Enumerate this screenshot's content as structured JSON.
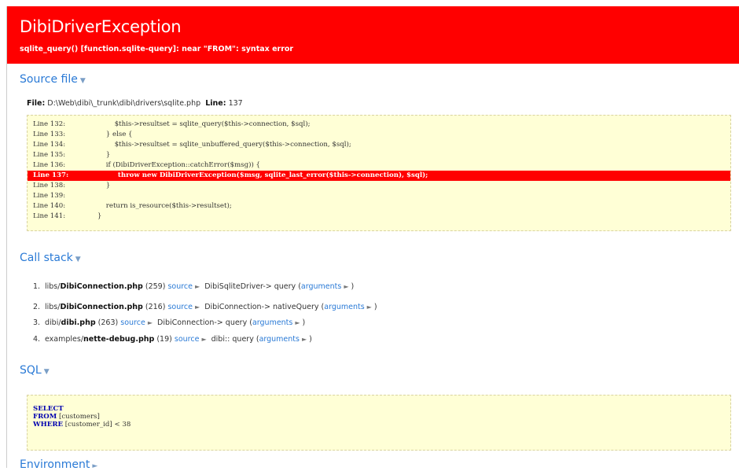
{
  "header": {
    "title": "DibiDriverException",
    "message": "sqlite_query() [function.sqlite-query]: near \"FROM\": syntax error"
  },
  "source_file": {
    "heading": "Source file",
    "toggle": "▼",
    "file_label": "File:",
    "file_path": "D:\\Web\\dibi\\_trunk\\dibi\\drivers\\sqlite.php",
    "line_label": "Line:",
    "line_number": "137",
    "lines": [
      {
        "ln": "Line 132:",
        "code": "                $this->resultset = sqlite_query($this->connection, $sql);"
      },
      {
        "ln": "Line 133:",
        "code": "            } else {"
      },
      {
        "ln": "Line 134:",
        "code": "                $this->resultset = sqlite_unbuffered_query($this->connection, $sql);"
      },
      {
        "ln": "Line 135:",
        "code": "            }"
      },
      {
        "ln": "Line 136:",
        "code": "            if (DibiDriverException::catchError($msg)) {"
      },
      {
        "ln": "Line 137:",
        "code": "                throw new DibiDriverException($msg, sqlite_last_error($this->connection), $sql);"
      },
      {
        "ln": "Line 138:",
        "code": "            }"
      },
      {
        "ln": "Line 139:",
        "code": ""
      },
      {
        "ln": "Line 140:",
        "code": "            return is_resource($this->resultset);"
      },
      {
        "ln": "Line 141:",
        "code": "        }"
      }
    ]
  },
  "call_stack": {
    "heading": "Call stack",
    "toggle": "▼",
    "source_label": "source",
    "arguments_label": "arguments",
    "items": [
      {
        "num": "1.",
        "dir": "libs/",
        "file": "DibiConnection.php",
        "line": "(259)",
        "call": "DibiSqliteDriver-> query"
      },
      {
        "num": "2.",
        "dir": "libs/",
        "file": "DibiConnection.php",
        "line": "(216)",
        "call": "DibiConnection-> nativeQuery"
      },
      {
        "num": "3.",
        "dir": "dibi/",
        "file": "dibi.php",
        "line": "(263)",
        "call": "DibiConnection-> query"
      },
      {
        "num": "4.",
        "dir": "examples/",
        "file": "nette-debug.php",
        "line": "(19)",
        "call": "dibi:: query"
      }
    ]
  },
  "sql": {
    "heading": "SQL",
    "toggle": "▼",
    "lines": [
      {
        "kw": "SELECT",
        "rest": ""
      },
      {
        "kw": "FROM",
        "rest": " [customers]"
      },
      {
        "kw": "WHERE",
        "rest": " [customer_id] < 38"
      }
    ]
  },
  "environment": {
    "heading": "Environment",
    "toggle": "►"
  }
}
